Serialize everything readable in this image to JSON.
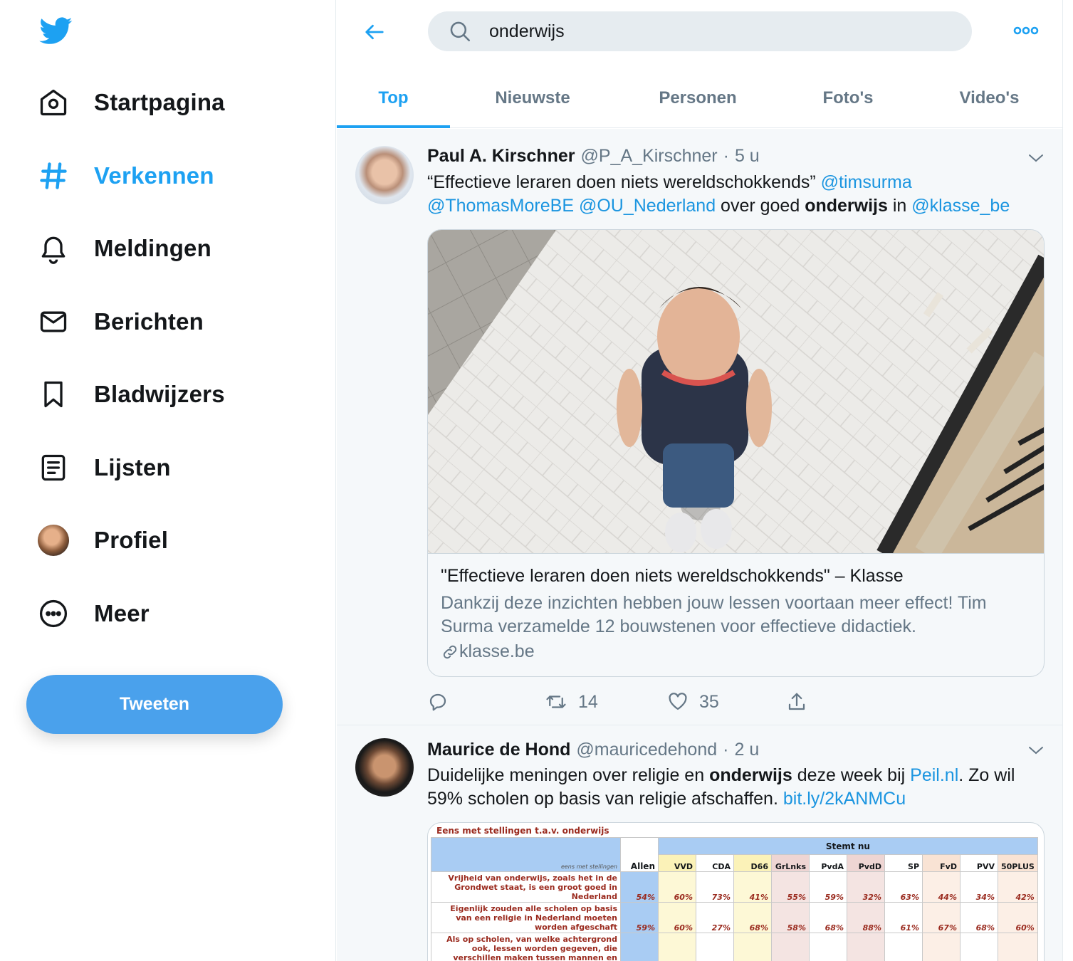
{
  "sidebar": {
    "logo": "twitter-bird-icon",
    "nav": [
      {
        "label": "Startpagina",
        "icon": "home-icon",
        "active": false
      },
      {
        "label": "Verkennen",
        "icon": "hashtag-icon",
        "active": true
      },
      {
        "label": "Meldingen",
        "icon": "bell-icon",
        "active": false
      },
      {
        "label": "Berichten",
        "icon": "envelope-icon",
        "active": false
      },
      {
        "label": "Bladwijzers",
        "icon": "bookmark-icon",
        "active": false
      },
      {
        "label": "Lijsten",
        "icon": "list-icon",
        "active": false
      },
      {
        "label": "Profiel",
        "icon": "avatar",
        "active": false
      },
      {
        "label": "Meer",
        "icon": "more-circle-icon",
        "active": false
      }
    ],
    "tweet_button": "Tweeten"
  },
  "search": {
    "query": "onderwijs"
  },
  "tabs": [
    {
      "label": "Top",
      "active": true
    },
    {
      "label": "Nieuwste",
      "active": false
    },
    {
      "label": "Personen",
      "active": false
    },
    {
      "label": "Foto's",
      "active": false
    },
    {
      "label": "Video's",
      "active": false
    }
  ],
  "tweets": [
    {
      "name": "Paul A. Kirschner",
      "handle": "@P_A_Kirschner",
      "time": "5 u",
      "text": {
        "quote": "“Effectieve leraren doen niets wereldschokkends”",
        "mention1": "@timsurma",
        "mention2": "@ThomasMoreBE",
        "mention3": "@OU_Nederland",
        "mid": "over goed",
        "keyword": "onderwijs",
        "in": "in",
        "mention4": "@klasse_be"
      },
      "card": {
        "title": "\"Effectieve leraren doen niets wereldschokkends\" – Klasse",
        "description": "Dankzij deze inzichten hebben jouw lessen voortaan meer effect! Tim Surma verzamelde 12 bouwstenen voor effectieve didactiek.",
        "domain": "klasse.be"
      },
      "retweets": "14",
      "likes": "35"
    },
    {
      "name": "Maurice de Hond",
      "handle": "@mauricedehond",
      "time": "2 u",
      "text": {
        "pre": "Duidelijke meningen over religie en",
        "keyword": "onderwijs",
        "mid": "deze week bij",
        "link1": "Peil.nl",
        "post": ". Zo wil 59% scholen op basis van religie afschaffen.",
        "link2": "bit.ly/2kANMCu"
      },
      "poll": {
        "title": "Eens met stellingen t.a.v. onderwijs",
        "group_header": "Stemt nu",
        "corner_label": "eens met stellingen",
        "columns": [
          "Allen",
          "VVD",
          "CDA",
          "D66",
          "GrLnks",
          "PvdA",
          "PvdD",
          "SP",
          "FvD",
          "PVV",
          "50PLUS"
        ],
        "rows": [
          {
            "statement": "Vrijheid van onderwijs, zoals het in de Grondwet staat, is een groot goed in Nederland",
            "values": [
              "54%",
              "60%",
              "73%",
              "41%",
              "55%",
              "59%",
              "32%",
              "63%",
              "44%",
              "34%",
              "42%"
            ]
          },
          {
            "statement": "Eigenlijk zouden alle scholen op basis van een religie in Nederland moeten worden afgeschaft",
            "values": [
              "59%",
              "60%",
              "27%",
              "68%",
              "58%",
              "68%",
              "88%",
              "61%",
              "67%",
              "68%",
              "60%"
            ]
          },
          {
            "statement": "Als op scholen, van welke achtergrond ook, lessen worden gegeven, die verschillen maken tussen mannen en",
            "values": [
              "",
              "",
              "",
              "",
              "",
              "",
              "",
              "",
              "",
              "",
              ""
            ]
          }
        ]
      }
    }
  ]
}
